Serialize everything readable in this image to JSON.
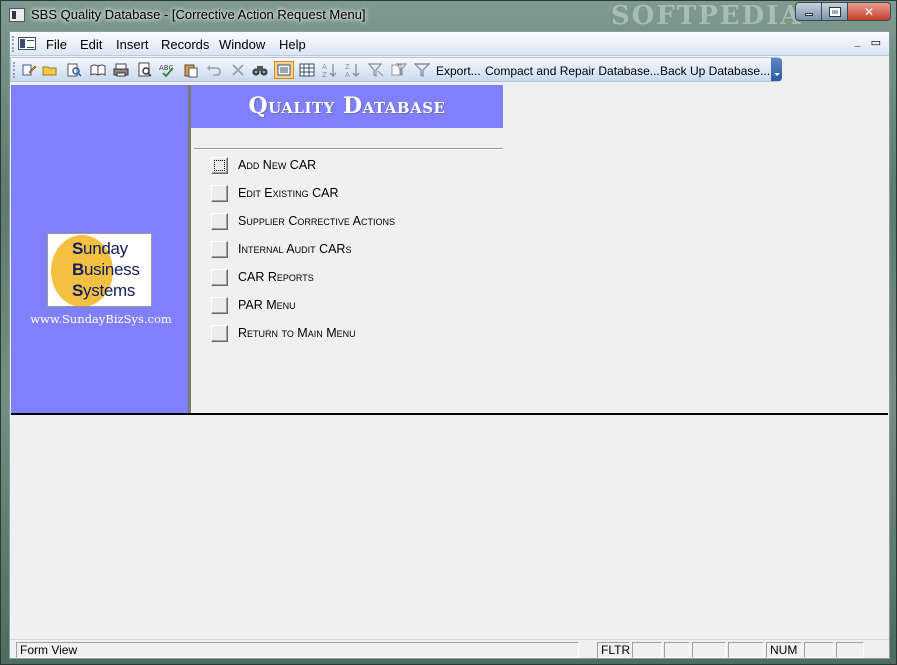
{
  "window": {
    "title": "SBS Quality Database - [Corrective Action Request Menu]",
    "watermark": "SOFTPEDIA",
    "min_glyph": "",
    "max_glyph": "",
    "close_glyph": "✕"
  },
  "menubar": {
    "items": [
      "File",
      "Edit",
      "Insert",
      "Records",
      "Window",
      "Help"
    ],
    "mdi_min": "_",
    "mdi_restore": "▭"
  },
  "toolbar": {
    "export_label": "Export...",
    "compact_label": "Compact and Repair Database...",
    "backup_label": "Back Up Database..."
  },
  "form": {
    "title": "Quality Database",
    "logo": {
      "line1_first": "S",
      "line1_rest": "unday",
      "line2_first": "B",
      "line2_rest": "usiness",
      "line3_first": "S",
      "line3_rest": "ystems"
    },
    "url": "www.SundayBizSys.com",
    "commands": [
      "Add New CAR",
      "Edit Existing CAR",
      "Supplier Corrective Actions",
      "Internal Audit CARs",
      "CAR Reports",
      "PAR Menu",
      "Return to Main Menu"
    ]
  },
  "statusbar": {
    "mode": "Form View",
    "fltr": "FLTR",
    "num": "NUM"
  },
  "colors": {
    "form_accent": "#8080ff",
    "logo_circle": "#f4c042",
    "logo_text": "#111d5e"
  }
}
